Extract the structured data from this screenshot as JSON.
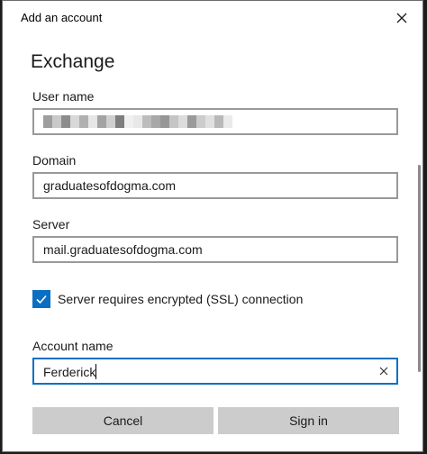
{
  "window": {
    "title": "Add an account",
    "close_icon": "close-icon"
  },
  "form": {
    "heading": "Exchange",
    "user_name": {
      "label": "User name",
      "value": "",
      "redacted": true
    },
    "domain": {
      "label": "Domain",
      "value": "graduatesofdogma.com"
    },
    "server": {
      "label": "Server",
      "value": "mail.graduatesofdogma.com"
    },
    "ssl": {
      "label": "Server requires encrypted (SSL) connection",
      "checked": true
    },
    "account_name": {
      "label": "Account name",
      "value": "Ferderick"
    }
  },
  "buttons": {
    "cancel": "Cancel",
    "sign_in": "Sign in"
  },
  "colors": {
    "accent": "#0a6fc2",
    "button_bg": "#cccccc",
    "input_border": "#999999"
  }
}
